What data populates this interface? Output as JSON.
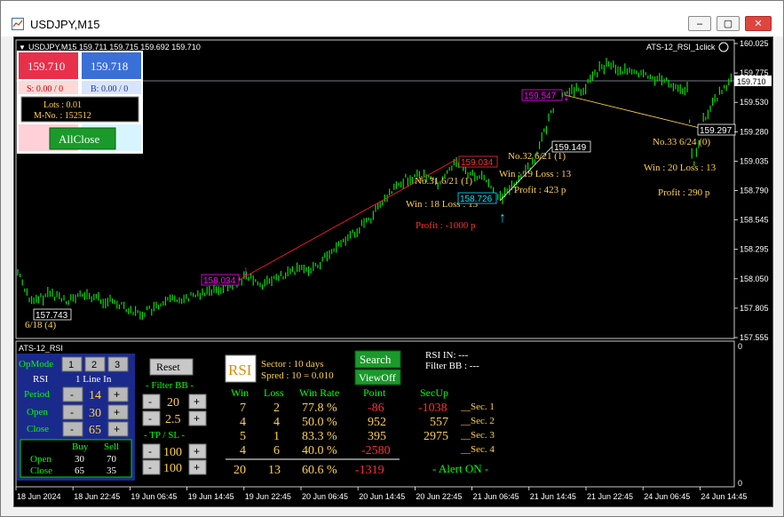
{
  "window": {
    "title": "USDJPY,M15",
    "min": "–",
    "max": "▢",
    "close": "✕"
  },
  "chart": {
    "header": "USDJPY,M15  159.711 159.715 159.692 159.710",
    "expert": "ATS-12_RSI_1click",
    "price_axis": [
      "160.025",
      "159.775",
      "159.530",
      "159.280",
      "159.035",
      "158.790",
      "158.545",
      "158.295",
      "158.050",
      "157.805",
      "157.555"
    ],
    "current_price": "159.710",
    "time_axis": [
      "18 Jun 2024",
      "18 Jun 22:45",
      "19 Jun 06:45",
      "19 Jun 14:45",
      "19 Jun 22:45",
      "20 Jun 06:45",
      "20 Jun 14:45",
      "20 Jun 22:45",
      "21 Jun 06:45",
      "21 Jun 14:45",
      "21 Jun 22:45",
      "24 Jun 06:45",
      "24 Jun 14:45"
    ],
    "sub_axis_top": "0",
    "sub_axis_bottom": "0"
  },
  "trade_panel": {
    "sell_price": "159.710",
    "buy_price": "159.718",
    "sell_info": "S: 0.00 / 0",
    "buy_info": "B: 0.00 / 0",
    "lots": "Lots : 0.01",
    "magic": "M-No. : 152512",
    "allclose": "AllClose"
  },
  "labels": {
    "p1": "157.743",
    "d1": "6/18 (4)",
    "p2": "158.034",
    "p3": "159.034",
    "n3": "No.31   6/21 (1)",
    "w3": "Win : 18   Loss : 13",
    "pr3": "Profit : -1000 p",
    "p4": "158.726",
    "p5": "159.149",
    "n5": "No.32   6/21 (1)",
    "w5": "Win : 19   Loss : 13",
    "pr5": "Profit : 423 p",
    "p6": "159.547",
    "p7": "159.297",
    "n7": "No.33   6/24 (0)",
    "w7": "Win : 20   Loss : 13",
    "pr7": "Profit : 290 p"
  },
  "sub": {
    "title": "ATS-12_RSI",
    "opmode": "OpMode",
    "m1": "1",
    "m2": "2",
    "m3": "3",
    "rsi": "RSI",
    "rsi_val": "1  Line In",
    "period": "Period",
    "period_val": "14",
    "open": "Open",
    "open_val": "30",
    "close": "Close",
    "close_val": "65",
    "buy_h": "Buy",
    "sell_h": "Sell",
    "open_buy": "30",
    "open_sell": "70",
    "close_buy": "65",
    "close_sell": "35",
    "minus": "-",
    "plus": "+",
    "reset": "Reset",
    "filter_bb": "- Filter BB -",
    "bb1": "20",
    "bb2": "2.5",
    "tpsl": "-  TP  /  SL  -",
    "tp": "100",
    "sl": "100",
    "logo": "RSI",
    "sector": "Sector : 10 days",
    "spread": "Spred : 10 = 0.010",
    "search": "Search",
    "viewoff": "ViewOff",
    "rsi_in": "RSI IN: ---",
    "filter_bb_val": "Filter BB   : ---",
    "headers": [
      "Win",
      "Loss",
      "Win Rate",
      "Point",
      "SecUp"
    ],
    "rows": [
      {
        "win": "7",
        "loss": "2",
        "rate": "77.8 %",
        "point": "-86",
        "secup": "-1038",
        "sec": "Sec. 1"
      },
      {
        "win": "4",
        "loss": "4",
        "rate": "50.0 %",
        "point": "952",
        "secup": "557",
        "sec": "Sec. 2"
      },
      {
        "win": "5",
        "loss": "1",
        "rate": "83.3 %",
        "point": "395",
        "secup": "2975",
        "sec": "Sec. 3"
      },
      {
        "win": "4",
        "loss": "6",
        "rate": "40.0 %",
        "point": "-2580",
        "secup": "",
        "sec": "Sec. 4"
      }
    ],
    "total": {
      "win": "20",
      "loss": "13",
      "rate": "60.6 %",
      "point": "-1319"
    },
    "alert": "- Alert ON -"
  },
  "colors": {
    "green": "#00ff00",
    "gold": "#ffd24a",
    "red": "#ff3030",
    "magenta": "#ff00ff",
    "cyan": "#00e5ff"
  }
}
